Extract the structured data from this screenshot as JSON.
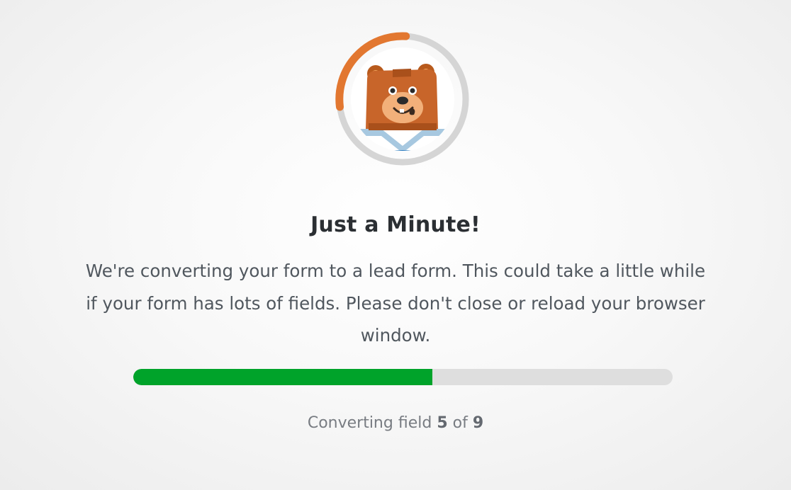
{
  "loader": {
    "mascot_icon": "bear-mascot-icon",
    "spinner_color": "#e27730",
    "spinner_track_color": "#d5d5d5"
  },
  "dialog": {
    "title": "Just a Minute!",
    "message": "We're converting your form to a lead form. This could take a little while if your form has lots of fields. Please don't close or reload your browser window."
  },
  "progress": {
    "percent": 55.5,
    "fill_color": "#00a32a",
    "track_color": "#dedede"
  },
  "status": {
    "prefix": "Converting field",
    "current": "5",
    "separator": "of",
    "total": "9"
  }
}
